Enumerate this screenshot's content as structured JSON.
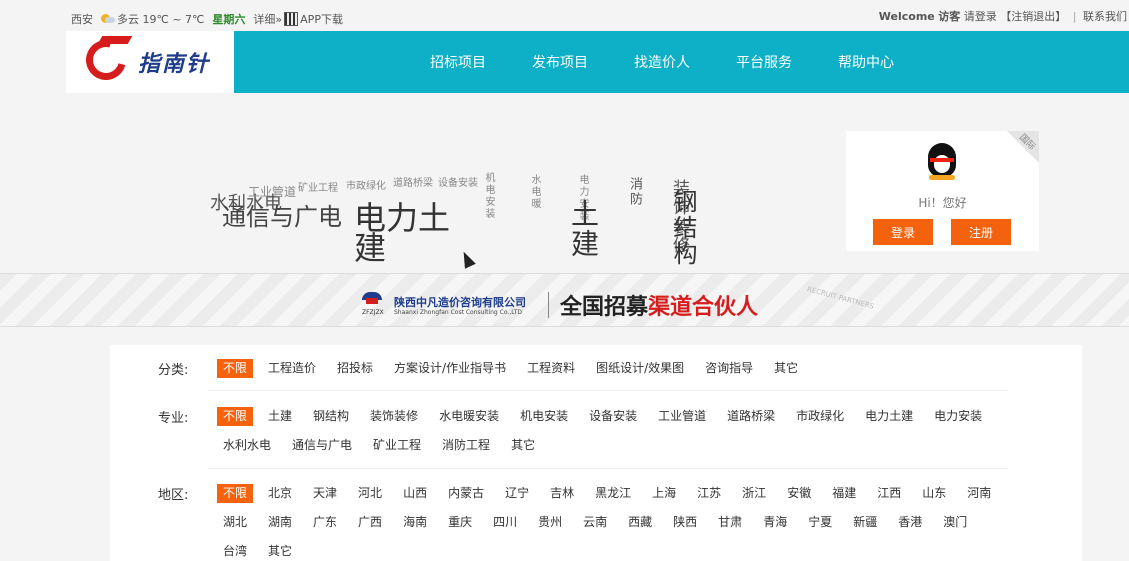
{
  "topbar": {
    "city": "西安",
    "weather": "多云 19℃ ~ 7℃",
    "weekday": "星期六",
    "detail": "详细»",
    "app_download": "APP下载",
    "welcome": "Welcome",
    "visitor": "访客",
    "login_prompt": "请登录",
    "logout": "【注销退出】",
    "contact": "联系我们"
  },
  "logo": {
    "text": "指南针"
  },
  "nav": {
    "items": [
      "招标项目",
      "发布项目",
      "找造价人",
      "平台服务",
      "帮助中心"
    ]
  },
  "scatter": {
    "items": [
      "水利水电",
      "工业管道",
      "矿业工程",
      "市政绿化",
      "道路桥梁",
      "设备安装",
      "机电安装",
      "水电暖",
      "电力安装",
      "消防",
      "装饰装修",
      "通信与广电",
      "电力土建",
      "土建",
      "钢结构"
    ]
  },
  "login_box": {
    "corner": "国际",
    "hello": "Hi！您好",
    "login": "登录",
    "register": "注册"
  },
  "banner": {
    "logo_sub": "ZFZJZX",
    "company": "陕西中凡造价咨询有限公司",
    "company_en": "Shaanxi Zhongfan Cost Consulting Co.,LTD",
    "slogan_a": "全国招募",
    "slogan_b": "渠道合伙人",
    "deco": "RECRUIT PARTNERS"
  },
  "filters": {
    "category": {
      "label": "分类:",
      "options": [
        "不限",
        "工程造价",
        "招投标",
        "方案设计/作业指导书",
        "工程资料",
        "图纸设计/效果图",
        "咨询指导",
        "其它"
      ]
    },
    "major": {
      "label": "专业:",
      "options": [
        "不限",
        "土建",
        "钢结构",
        "装饰装修",
        "水电暖安装",
        "机电安装",
        "设备安装",
        "工业管道",
        "道路桥梁",
        "市政绿化",
        "电力土建",
        "电力安装",
        "水利水电",
        "通信与广电",
        "矿业工程",
        "消防工程",
        "其它"
      ]
    },
    "region": {
      "label": "地区:",
      "options": [
        "不限",
        "北京",
        "天津",
        "河北",
        "山西",
        "内蒙古",
        "辽宁",
        "吉林",
        "黑龙江",
        "上海",
        "江苏",
        "浙江",
        "安徽",
        "福建",
        "江西",
        "山东",
        "河南",
        "湖北",
        "湖南",
        "广东",
        "广西",
        "海南",
        "重庆",
        "四川",
        "贵州",
        "云南",
        "西藏",
        "陕西",
        "甘肃",
        "青海",
        "宁夏",
        "新疆",
        "香港",
        "澳门",
        "台湾",
        "其它"
      ]
    }
  },
  "colors": {
    "nav_bg": "#0db0c6",
    "accent": "#f4620d",
    "brand_red": "#d61d1d",
    "brand_blue": "#1e3d8c"
  }
}
